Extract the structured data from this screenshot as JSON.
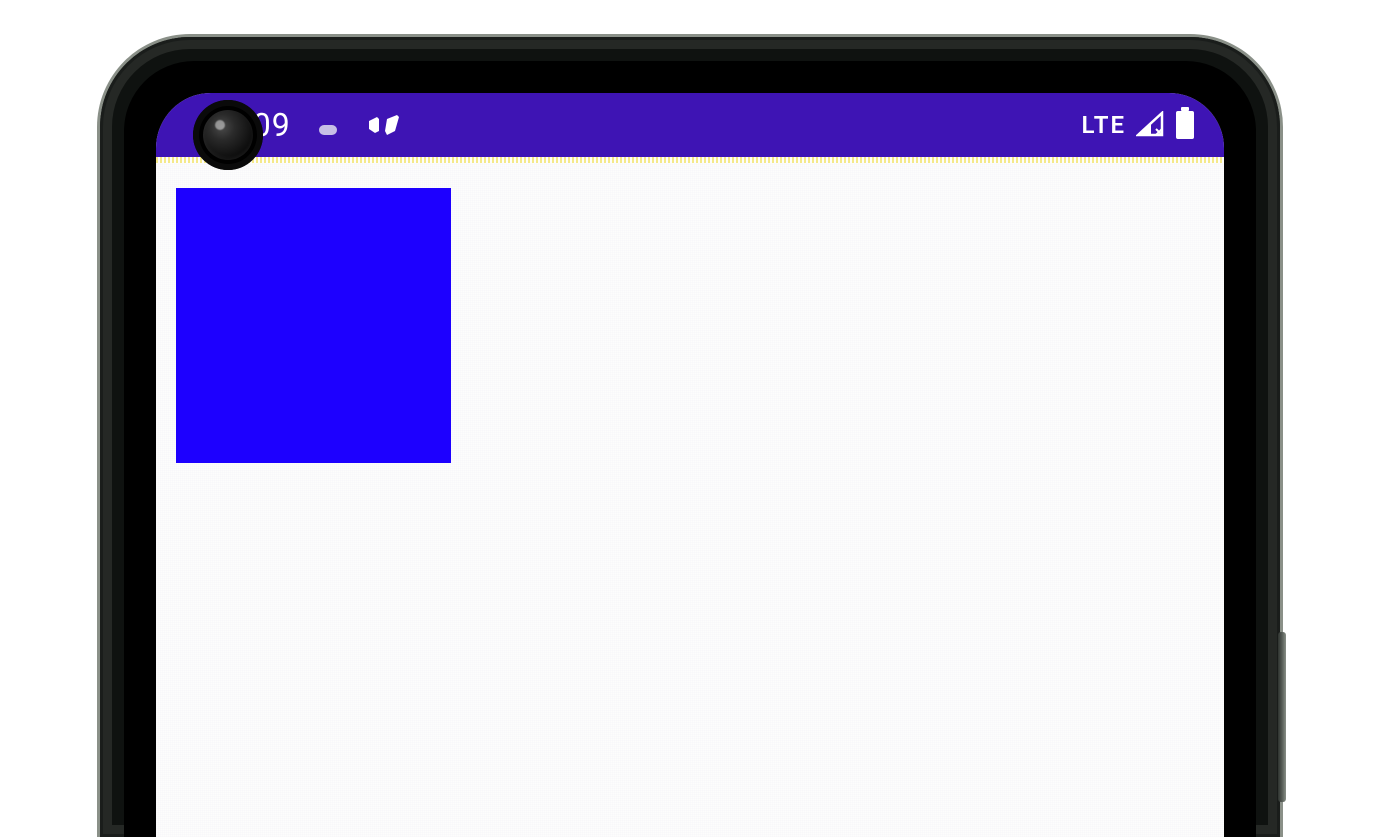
{
  "status_bar": {
    "time": "10:09",
    "network_label": "LTE"
  },
  "colors": {
    "status_bar_bg": "#3e14b4",
    "blue_box": "#1d00ff",
    "screen_bg": "#fdfdfc"
  }
}
